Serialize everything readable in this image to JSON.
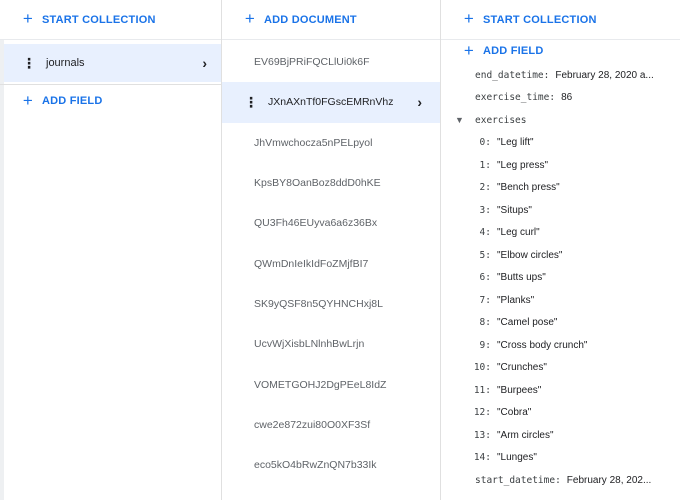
{
  "collections_panel": {
    "start_collection_label": "START COLLECTION",
    "collection_name": "journals",
    "add_field_label": "ADD FIELD"
  },
  "documents_panel": {
    "add_document_label": "ADD DOCUMENT",
    "selected_index": 1,
    "documents": [
      "EV69BjPRiFQCLlUi0k6F",
      "JXnAXnTf0FGscEMRnVhz",
      "JhVmwchocza5nPELpyol",
      "KpsBY8OanBoz8ddD0hKE",
      "QU3Fh46EUyva6a6z36Bx",
      "QWmDnIeIkIdFoZMjfBI7",
      "SK9yQSF8n5QYHNCHxj8L",
      "UcvWjXisbLNlnhBwLrjn",
      "VOMETGOHJ2DgPEeL8IdZ",
      "cwe2e872zui80O0XF3Sf",
      "eco5kO4bRwZnQN7b33Ik"
    ]
  },
  "fields_panel": {
    "start_collection_label": "START COLLECTION",
    "add_field_label": "ADD FIELD",
    "end_datetime": {
      "key": "end_datetime:",
      "value": "February 28, 2020 a..."
    },
    "exercise_time": {
      "key": "exercise_time:",
      "value": "86"
    },
    "exercises_key": "exercises",
    "exercises": [
      {
        "index": "0:",
        "value": "\"Leg lift\""
      },
      {
        "index": "1:",
        "value": "\"Leg press\""
      },
      {
        "index": "2:",
        "value": "\"Bench press\""
      },
      {
        "index": "3:",
        "value": "\"Situps\""
      },
      {
        "index": "4:",
        "value": "\"Leg curl\""
      },
      {
        "index": "5:",
        "value": "\"Elbow circles\""
      },
      {
        "index": "6:",
        "value": "\"Butts ups\""
      },
      {
        "index": "7:",
        "value": "\"Planks\""
      },
      {
        "index": "8:",
        "value": "\"Camel pose\""
      },
      {
        "index": "9:",
        "value": "\"Cross body crunch\""
      },
      {
        "index": "10:",
        "value": "\"Crunches\""
      },
      {
        "index": "11:",
        "value": "\"Burpees\""
      },
      {
        "index": "12:",
        "value": "\"Cobra\""
      },
      {
        "index": "13:",
        "value": "\"Arm circles\""
      },
      {
        "index": "14:",
        "value": "\"Lunges\""
      }
    ],
    "start_datetime": {
      "key": "start_datetime:",
      "value": "February 28, 202..."
    }
  },
  "colors": {
    "accent": "#1a73e8",
    "selected_row": "#e8f0fe"
  }
}
